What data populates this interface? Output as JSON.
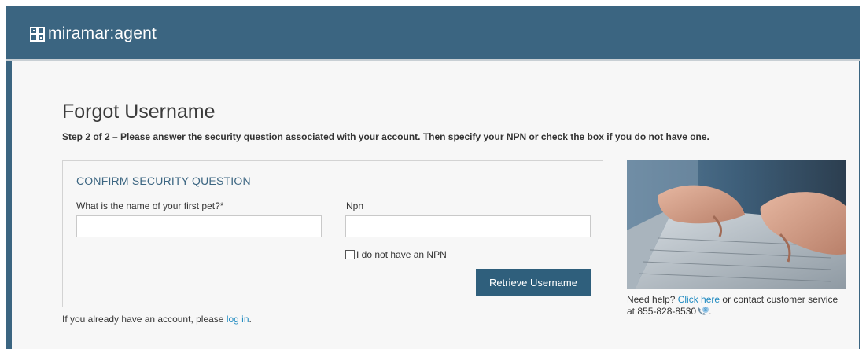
{
  "brand": {
    "logo_text": "miramar:agent"
  },
  "page": {
    "title": "Forgot Username",
    "step_text": "Step 2 of 2 – Please answer the security question associated with your account. Then specify your NPN or check the box if you do not have one."
  },
  "form": {
    "section_title": "CONFIRM SECURITY QUESTION",
    "security_question_label": "What is the name of your first pet?*",
    "security_answer_value": "",
    "npn_label": "Npn",
    "npn_value": "",
    "no_npn_label": "I do not have an NPN",
    "no_npn_checked": false,
    "submit_label": "Retrieve Username"
  },
  "login_prompt": {
    "text": "If you already have an account, please ",
    "link": "log in",
    "suffix": "."
  },
  "help": {
    "prefix": "Need help? ",
    "link": "Click here",
    "middle": " or contact customer service at 855-828-8530",
    "suffix": "."
  },
  "colors": {
    "header": "#3b6581",
    "accent": "#2f5f7c",
    "link": "#1f8ac0"
  },
  "icons": {
    "phone": "phone-icon",
    "logo": "logo-grid-icon"
  }
}
